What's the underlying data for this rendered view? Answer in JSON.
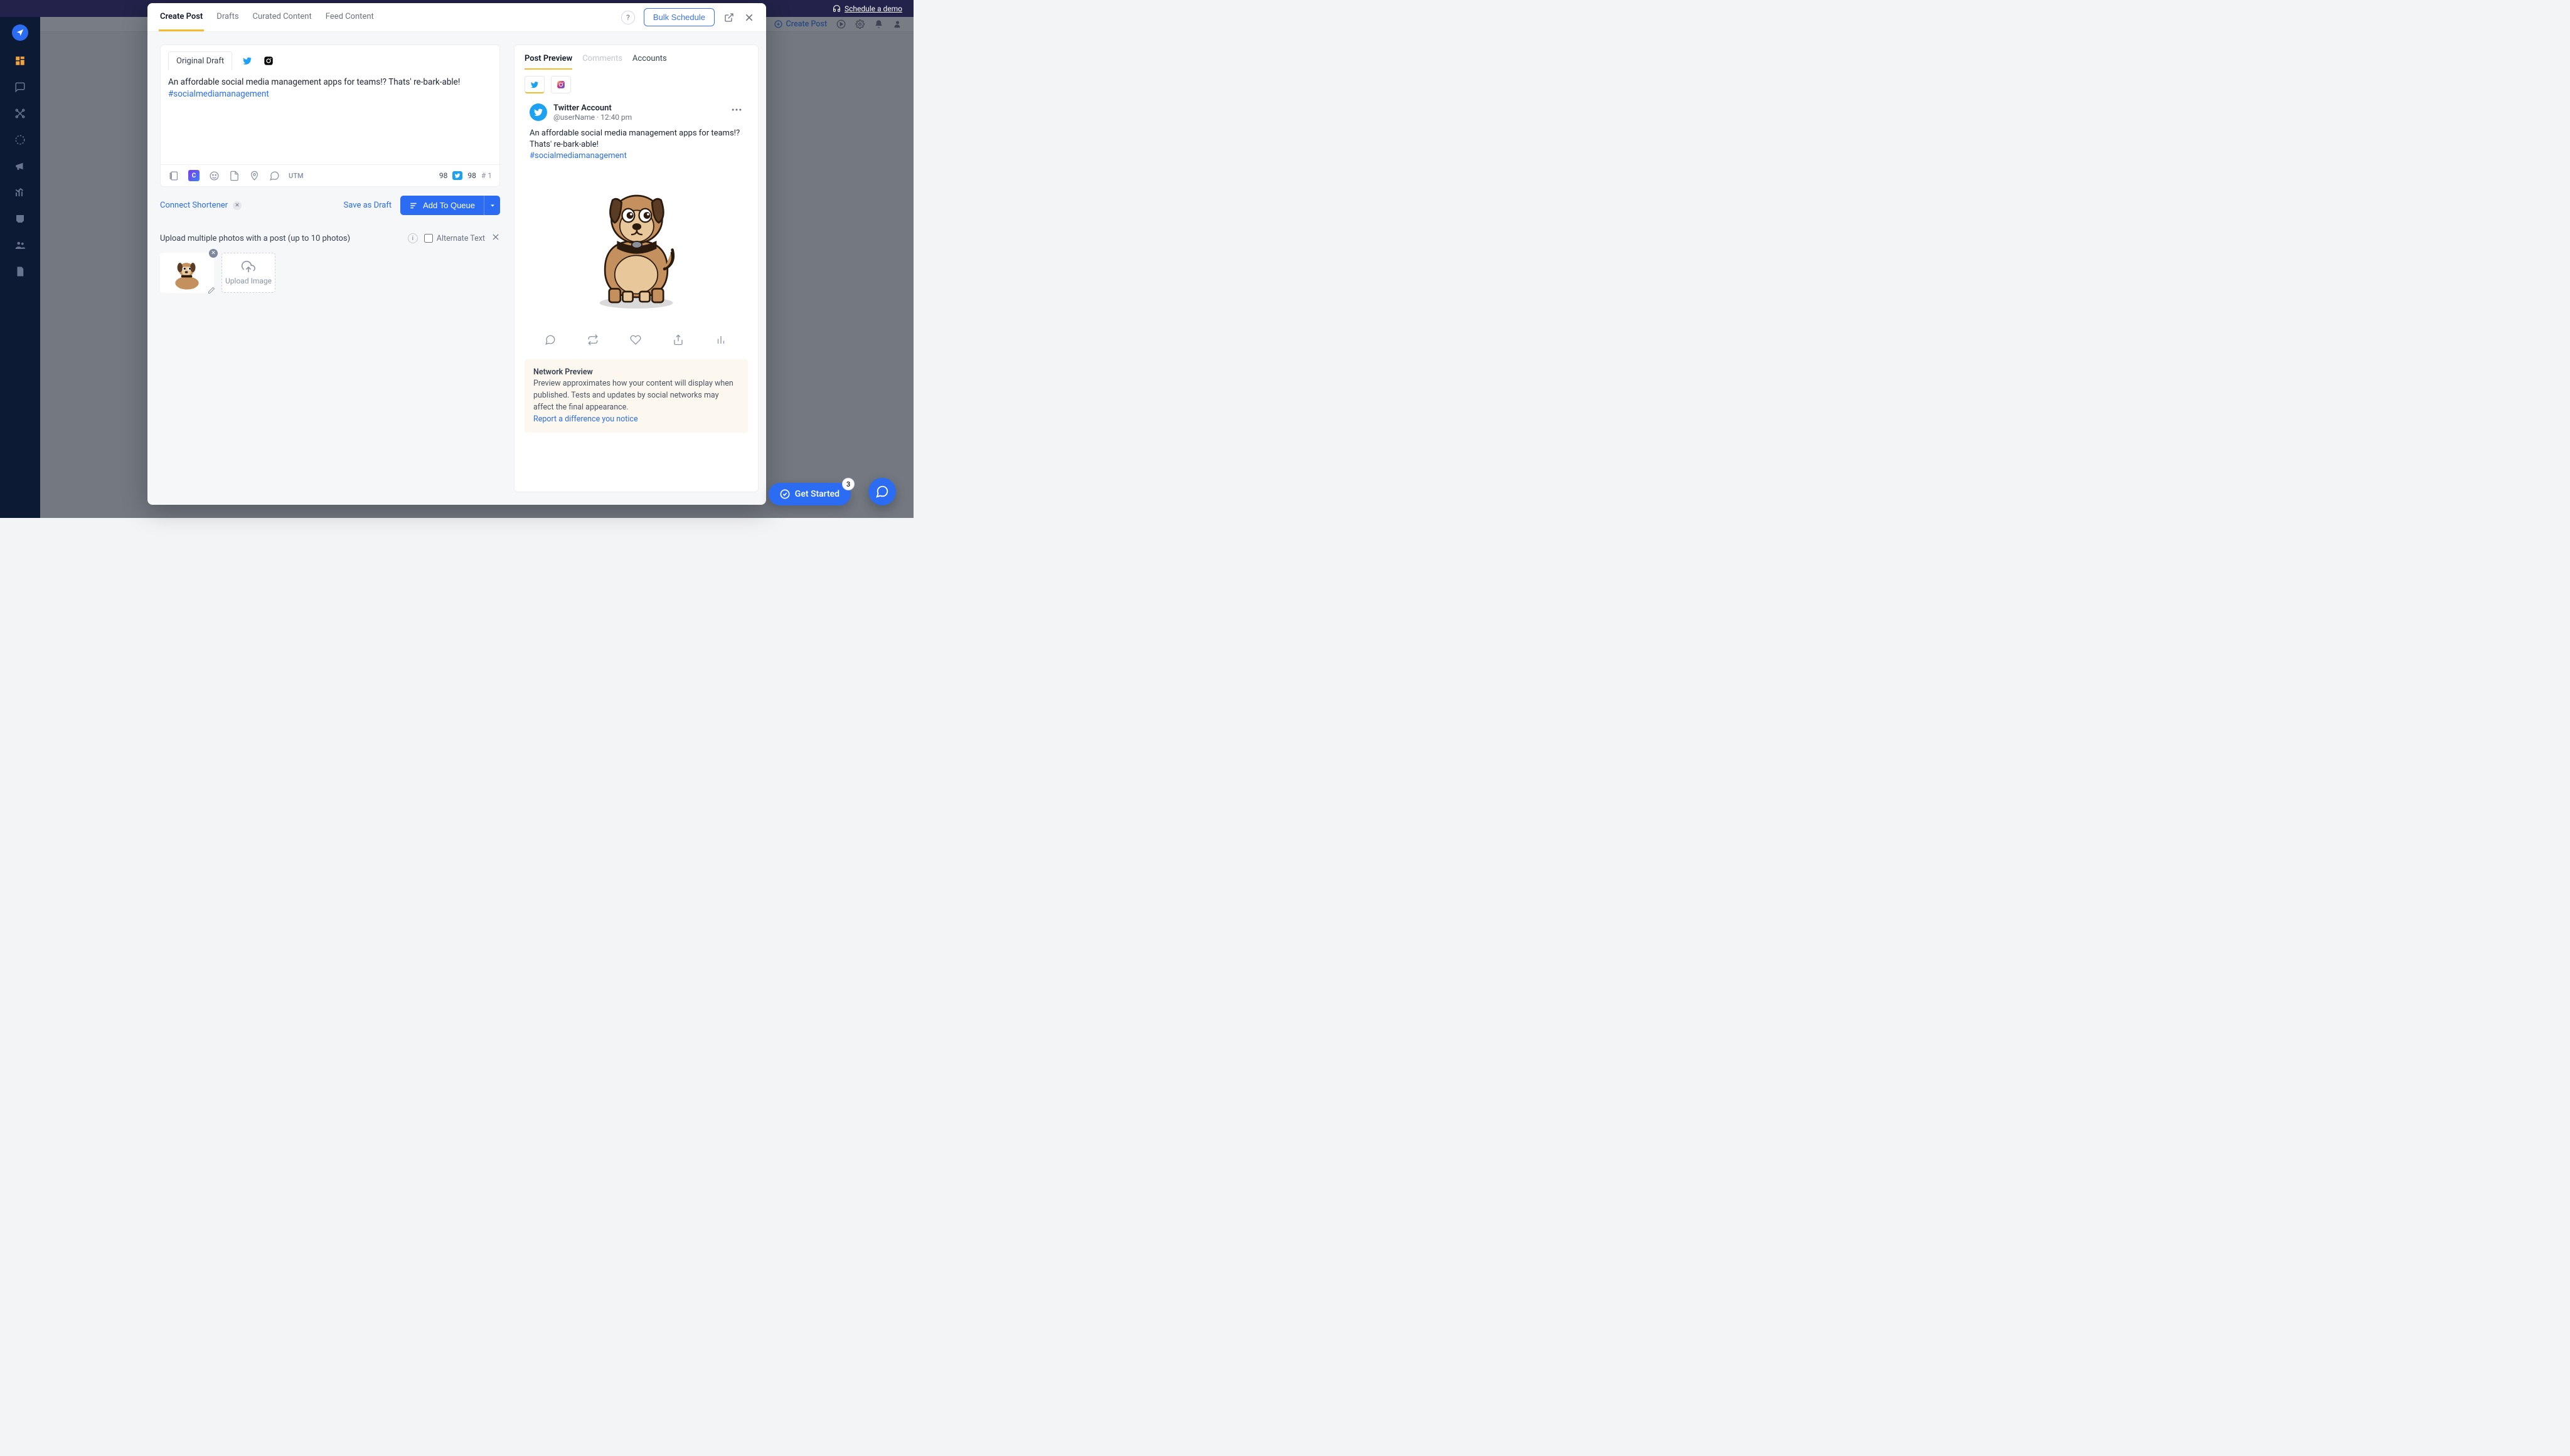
{
  "topbar": {
    "schedule_demo": "Schedule a demo"
  },
  "secondbar": {
    "create_post": "Create Post"
  },
  "modal": {
    "tabs": [
      "Create Post",
      "Drafts",
      "Curated Content",
      "Feed Content"
    ],
    "bulk_schedule": "Bulk Schedule"
  },
  "editor": {
    "tab_label": "Original Draft",
    "text_plain": "An affordable social media management apps for teams!? Thats' re-bark-able! ",
    "hashtag": "#socialmediamanagement",
    "utm_label": "UTM",
    "count_generic": "98",
    "count_twitter": "98",
    "count_hash": "# 1"
  },
  "actions": {
    "connect_shortener": "Connect Shortener",
    "save_as_draft": "Save as Draft",
    "add_to_queue": "Add To Queue"
  },
  "upload": {
    "title": "Upload multiple photos with a post (up to 10 photos)",
    "alternate_text": "Alternate Text",
    "upload_image": "Upload Image"
  },
  "preview": {
    "tabs": [
      "Post Preview",
      "Comments",
      "Accounts"
    ],
    "account_name": "Twitter Account",
    "account_handle": "@userName · 12:40 pm",
    "body_plain": "An affordable social media management apps for teams!? Thats' re-bark-able!",
    "hashtag": "#socialmediamanagement",
    "network_preview_title": "Network Preview",
    "network_preview_body": "Preview approximates how your content will display when published. Tests and updates by social networks may affect the final appearance.",
    "report_link": "Report a difference you notice"
  },
  "floating": {
    "get_started": "Get Started",
    "badge_count": "3"
  }
}
